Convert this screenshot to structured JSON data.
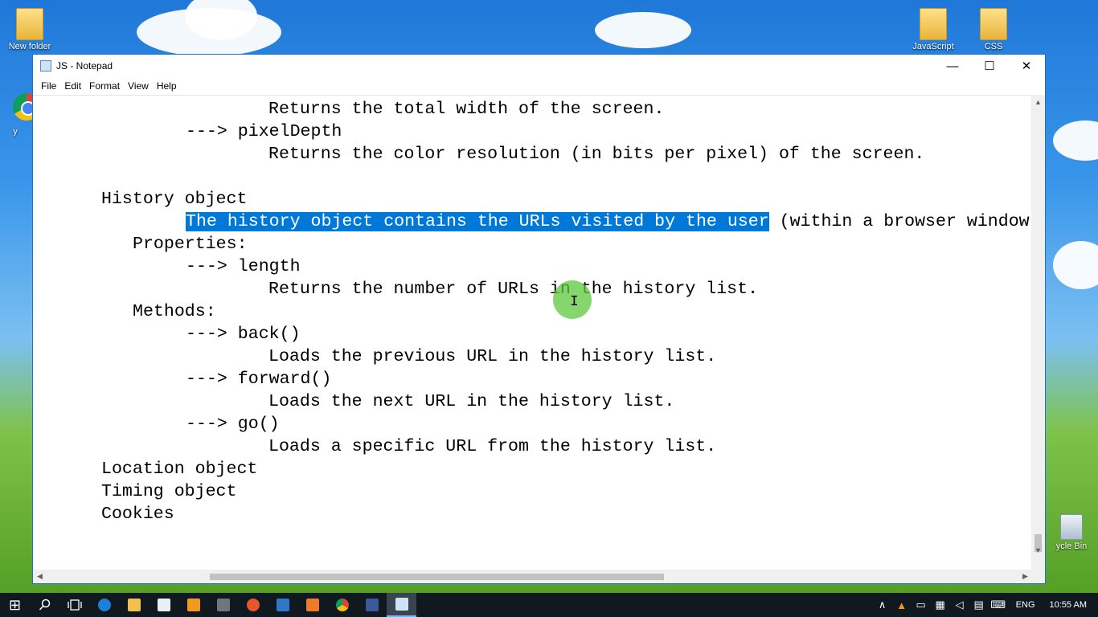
{
  "desktop": {
    "icons": [
      {
        "label": "New folder"
      },
      {
        "label": "JavaScript"
      },
      {
        "label": "CSS"
      },
      {
        "label": "ycle Bin"
      }
    ],
    "partial_label": "y"
  },
  "window": {
    "title": "JS - Notepad",
    "controls": {
      "minimize": "—",
      "maximize": "☐",
      "close": "✕"
    },
    "menu": [
      "File",
      "Edit",
      "Format",
      "View",
      "Help"
    ]
  },
  "editor": {
    "lines": [
      {
        "text": "Returns the total width of the screen."
      },
      {
        "text": "---> pixelDepth"
      },
      {
        "text": "Returns the color resolution (in bits per pixel) of the screen."
      },
      {
        "text": "History object"
      },
      {
        "selected": "The history object contains the URLs visited by the user",
        "rest": " (within a browser window"
      },
      {
        "text": "Properties:"
      },
      {
        "text": "---> length"
      },
      {
        "text": "Returns the number of URLs in the history list."
      },
      {
        "text": "Methods:"
      },
      {
        "text": "---> back()"
      },
      {
        "text": "Loads the previous URL in the history list."
      },
      {
        "text": "---> forward()"
      },
      {
        "text": "Loads the next URL in the history list."
      },
      {
        "text": "---> go()"
      },
      {
        "text": "Loads a specific URL from the history list."
      },
      {
        "text": "Location object"
      },
      {
        "text": "Timing object"
      },
      {
        "text": "Cookies"
      }
    ],
    "selection_color": "#0078d7"
  },
  "scrollbars": {
    "up": "▲",
    "down": "▼",
    "left": "◀",
    "right": "▶"
  },
  "cursor": {
    "glyph": "I"
  },
  "taskbar": {
    "start": "⊞",
    "icons": [
      "search-icon",
      "task-view-icon",
      "edge-icon",
      "file-explorer-icon",
      "store-icon",
      "media-icon",
      "calculator-icon",
      "firefox-icon",
      "mail-icon",
      "paint-icon",
      "chrome-icon",
      "facebook-icon",
      "notepad-icon"
    ],
    "tray": {
      "chevron": "∧",
      "language": "ENG",
      "time": "10:55 AM"
    }
  }
}
